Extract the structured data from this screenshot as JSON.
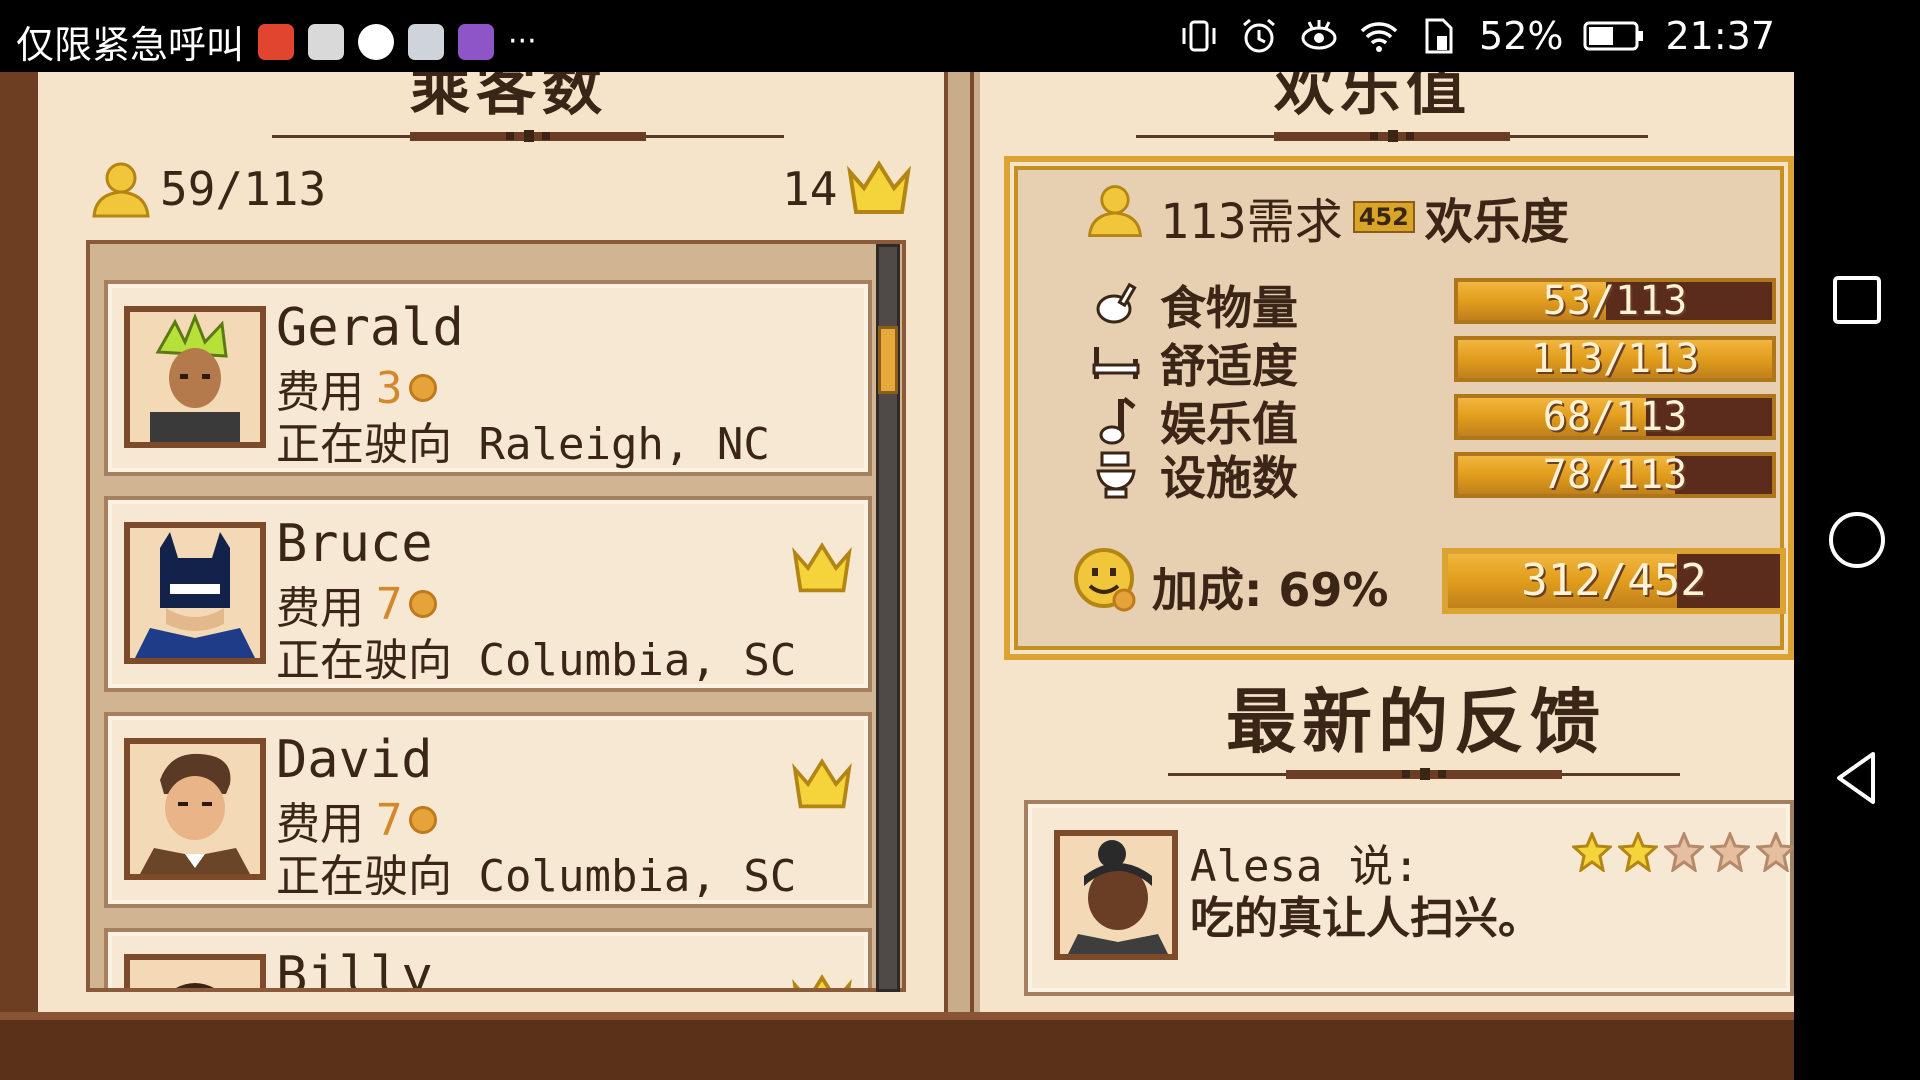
{
  "status_bar": {
    "carrier_text": "仅限紧急呼叫",
    "overflow": "···",
    "battery_percent": "52%",
    "time": "21:37",
    "icons": [
      "vibrate-icon",
      "alarm-icon",
      "eye-icon",
      "wifi-icon",
      "sim-icon",
      "battery-icon"
    ]
  },
  "left_page": {
    "title": "乘客数",
    "passenger_count": "59/113",
    "vip_count": "14"
  },
  "passengers": [
    {
      "name": "Gerald",
      "fee_label": "费用",
      "fee": "3",
      "dest": "正在驶向 Raleigh, NC",
      "vip": false
    },
    {
      "name": "Bruce",
      "fee_label": "费用",
      "fee": "7",
      "dest": "正在驶向 Columbia, SC",
      "vip": true
    },
    {
      "name": "David",
      "fee_label": "费用",
      "fee": "7",
      "dest": "正在驶向 Columbia, SC",
      "vip": true
    },
    {
      "name": "Billy",
      "fee_label": "",
      "fee": "",
      "dest": "",
      "vip": true
    }
  ],
  "right_page": {
    "title": "欢乐值",
    "needs_prefix": "113需求",
    "needs_badge": "452",
    "needs_suffix": "欢乐度",
    "stats": [
      {
        "label": "食物量",
        "value": "53/113",
        "fraction": 0.469,
        "icon": "drumstick-icon"
      },
      {
        "label": "舒适度",
        "value": "113/113",
        "fraction": 1.0,
        "icon": "bed-icon"
      },
      {
        "label": "娱乐值",
        "value": "68/113",
        "fraction": 0.602,
        "icon": "music-note-icon"
      },
      {
        "label": "设施数",
        "value": "78/113",
        "fraction": 0.69,
        "icon": "toilet-icon"
      }
    ],
    "bonus_label": "加成: 69%",
    "bonus_value": "312/452",
    "bonus_fraction": 0.69,
    "feedback_title": "最新的反馈",
    "feedback": {
      "speaker": "Alesa 说:",
      "text": "吃的真让人扫兴。",
      "stars_filled": 2,
      "stars_total": 5
    }
  },
  "colors": {
    "page": "#f5e3ca",
    "gold": "#dba431",
    "bar_fill": "#e19d1c",
    "bar_empty": "#5b2c1c",
    "text_dark": "#3a2517",
    "fee_orange": "#d2882b"
  }
}
